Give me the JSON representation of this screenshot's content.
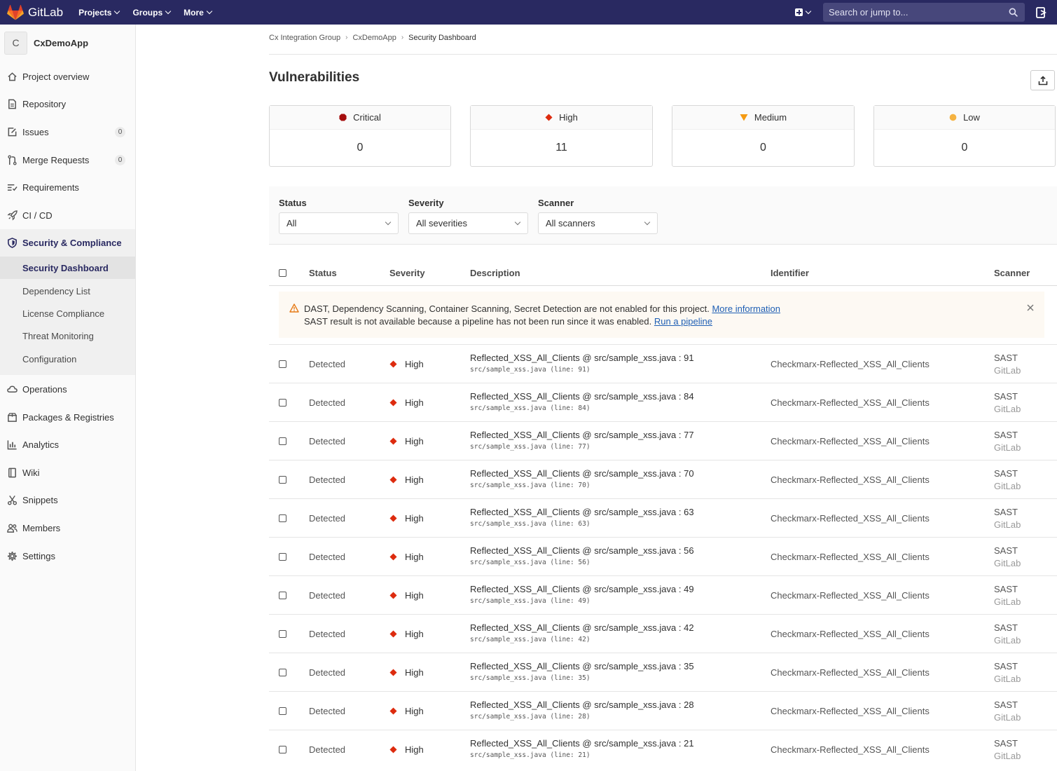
{
  "topbar": {
    "brand": "GitLab",
    "nav": [
      "Projects",
      "Groups",
      "More"
    ],
    "search_placeholder": "Search or jump to..."
  },
  "sidebar": {
    "avatar_letter": "C",
    "project_name": "CxDemoApp",
    "items": [
      {
        "label": "Project overview",
        "icon": "home-icon"
      },
      {
        "label": "Repository",
        "icon": "doc-icon"
      },
      {
        "label": "Issues",
        "icon": "issues-icon",
        "count": "0"
      },
      {
        "label": "Merge Requests",
        "icon": "merge-icon",
        "count": "0"
      },
      {
        "label": "Requirements",
        "icon": "requirements-icon"
      },
      {
        "label": "CI / CD",
        "icon": "rocket-icon"
      },
      {
        "label": "Security & Compliance",
        "icon": "shield-icon"
      },
      {
        "label": "Operations",
        "icon": "cloud-icon"
      },
      {
        "label": "Packages & Registries",
        "icon": "package-icon"
      },
      {
        "label": "Analytics",
        "icon": "chart-icon"
      },
      {
        "label": "Wiki",
        "icon": "book-icon"
      },
      {
        "label": "Snippets",
        "icon": "scissors-icon"
      },
      {
        "label": "Members",
        "icon": "users-icon"
      },
      {
        "label": "Settings",
        "icon": "gear-icon"
      }
    ],
    "sub_items": [
      "Security Dashboard",
      "Dependency List",
      "License Compliance",
      "Threat Monitoring",
      "Configuration"
    ]
  },
  "breadcrumb": [
    "Cx Integration Group",
    "CxDemoApp",
    "Security Dashboard"
  ],
  "page_title": "Vulnerabilities",
  "severity_cards": [
    {
      "label": "Critical",
      "count": "0",
      "color": "#a50e0e"
    },
    {
      "label": "High",
      "count": "11",
      "color": "#dd2b0e"
    },
    {
      "label": "Medium",
      "count": "0",
      "color": "#f59b12"
    },
    {
      "label": "Low",
      "count": "0",
      "color": "#f5b342"
    }
  ],
  "filters": [
    {
      "label": "Status",
      "value": "All"
    },
    {
      "label": "Severity",
      "value": "All severities"
    },
    {
      "label": "Scanner",
      "value": "All scanners"
    }
  ],
  "table": {
    "headers": [
      "Status",
      "Severity",
      "Description",
      "Identifier",
      "Scanner"
    ],
    "rows": [
      {
        "status": "Detected",
        "severity": "High",
        "title": "Reflected_XSS_All_Clients @ src/sample_xss.java : 91",
        "location": "src/sample_xss.java (line: 91)",
        "identifier": "Checkmarx-Reflected_XSS_All_Clients",
        "scanner": "SAST",
        "vendor": "GitLab"
      },
      {
        "status": "Detected",
        "severity": "High",
        "title": "Reflected_XSS_All_Clients @ src/sample_xss.java : 84",
        "location": "src/sample_xss.java (line: 84)",
        "identifier": "Checkmarx-Reflected_XSS_All_Clients",
        "scanner": "SAST",
        "vendor": "GitLab"
      },
      {
        "status": "Detected",
        "severity": "High",
        "title": "Reflected_XSS_All_Clients @ src/sample_xss.java : 77",
        "location": "src/sample_xss.java (line: 77)",
        "identifier": "Checkmarx-Reflected_XSS_All_Clients",
        "scanner": "SAST",
        "vendor": "GitLab"
      },
      {
        "status": "Detected",
        "severity": "High",
        "title": "Reflected_XSS_All_Clients @ src/sample_xss.java : 70",
        "location": "src/sample_xss.java (line: 70)",
        "identifier": "Checkmarx-Reflected_XSS_All_Clients",
        "scanner": "SAST",
        "vendor": "GitLab"
      },
      {
        "status": "Detected",
        "severity": "High",
        "title": "Reflected_XSS_All_Clients @ src/sample_xss.java : 63",
        "location": "src/sample_xss.java (line: 63)",
        "identifier": "Checkmarx-Reflected_XSS_All_Clients",
        "scanner": "SAST",
        "vendor": "GitLab"
      },
      {
        "status": "Detected",
        "severity": "High",
        "title": "Reflected_XSS_All_Clients @ src/sample_xss.java : 56",
        "location": "src/sample_xss.java (line: 56)",
        "identifier": "Checkmarx-Reflected_XSS_All_Clients",
        "scanner": "SAST",
        "vendor": "GitLab"
      },
      {
        "status": "Detected",
        "severity": "High",
        "title": "Reflected_XSS_All_Clients @ src/sample_xss.java : 49",
        "location": "src/sample_xss.java (line: 49)",
        "identifier": "Checkmarx-Reflected_XSS_All_Clients",
        "scanner": "SAST",
        "vendor": "GitLab"
      },
      {
        "status": "Detected",
        "severity": "High",
        "title": "Reflected_XSS_All_Clients @ src/sample_xss.java : 42",
        "location": "src/sample_xss.java (line: 42)",
        "identifier": "Checkmarx-Reflected_XSS_All_Clients",
        "scanner": "SAST",
        "vendor": "GitLab"
      },
      {
        "status": "Detected",
        "severity": "High",
        "title": "Reflected_XSS_All_Clients @ src/sample_xss.java : 35",
        "location": "src/sample_xss.java (line: 35)",
        "identifier": "Checkmarx-Reflected_XSS_All_Clients",
        "scanner": "SAST",
        "vendor": "GitLab"
      },
      {
        "status": "Detected",
        "severity": "High",
        "title": "Reflected_XSS_All_Clients @ src/sample_xss.java : 28",
        "location": "src/sample_xss.java (line: 28)",
        "identifier": "Checkmarx-Reflected_XSS_All_Clients",
        "scanner": "SAST",
        "vendor": "GitLab"
      },
      {
        "status": "Detected",
        "severity": "High",
        "title": "Reflected_XSS_All_Clients @ src/sample_xss.java : 21",
        "location": "src/sample_xss.java (line: 21)",
        "identifier": "Checkmarx-Reflected_XSS_All_Clients",
        "scanner": "SAST",
        "vendor": "GitLab"
      }
    ]
  },
  "alert": {
    "line1": "DAST, Dependency Scanning, Container Scanning, Secret Detection are not enabled for this project.",
    "link1": "More information",
    "line2": "SAST result is not available because a pipeline has not been run since it was enabled.",
    "link2": "Run a pipeline"
  }
}
